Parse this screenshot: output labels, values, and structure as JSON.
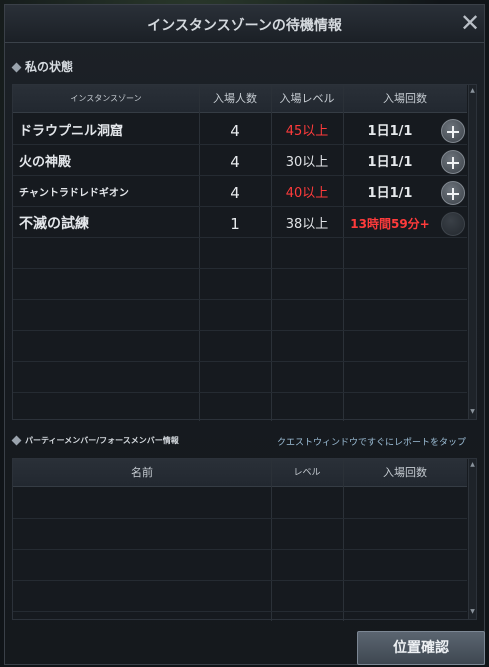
{
  "window": {
    "title": "インスタンスゾーンの待機情報"
  },
  "my_status": {
    "heading": "私の状態",
    "columns": [
      "インスタンスゾーン",
      "入場人数",
      "入場レベル",
      "入場回数"
    ],
    "rows": [
      {
        "name": "ドラウプニル洞窟",
        "count": "4",
        "level": "45以上",
        "level_color": "#ff3b3b",
        "entries": "1日1/1",
        "entries_red": false,
        "action": "plus"
      },
      {
        "name": "火の神殿",
        "count": "4",
        "level": "30以上",
        "level_color": "#e0e3e6",
        "entries": "1日1/1",
        "entries_red": false,
        "action": "plus"
      },
      {
        "name": "チャントラドレドギオン",
        "count": "4",
        "level": "40以上",
        "level_color": "#ff3b3b",
        "entries": "1日1/1",
        "entries_red": false,
        "action": "plus"
      },
      {
        "name": "不滅の試練",
        "count": "1",
        "level": "38以上",
        "level_color": "#e0e3e6",
        "entries": "13時間59分+",
        "entries_red": true,
        "action": "disabled"
      }
    ]
  },
  "party": {
    "heading": "パーティーメンバー/フォースメンバー情報",
    "link": "クエストウィンドウですぐにレポートをタップ",
    "columns": [
      "名前",
      "レベル",
      "入場回数"
    ]
  },
  "buttons": {
    "confirm": "位置確認"
  }
}
